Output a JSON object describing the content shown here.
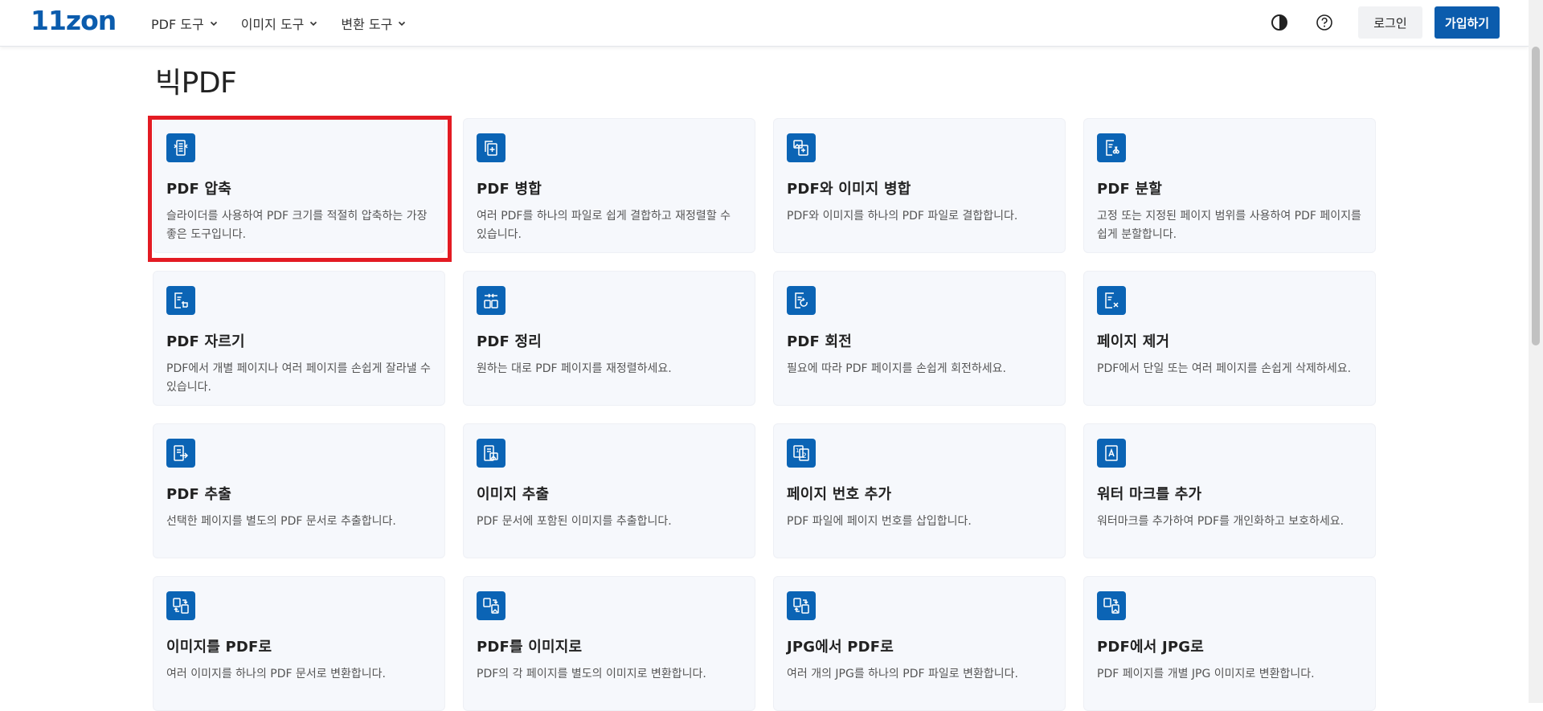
{
  "header": {
    "logo": "11zon",
    "nav": [
      {
        "label": "PDF 도구"
      },
      {
        "label": "이미지 도구"
      },
      {
        "label": "변환 도구"
      }
    ],
    "login_label": "로그인",
    "signup_label": "가입하기"
  },
  "page_title": "빅PDF",
  "colors": {
    "accent": "#0b5cad",
    "highlight": "#e31b23",
    "card_bg": "#f6f8fc"
  },
  "tools": [
    {
      "icon": "compress-icon",
      "title": "PDF 압축",
      "desc": "슬라이더를 사용하여 PDF 크기를 적절히 압축하는 가장 좋은 도구입니다."
    },
    {
      "icon": "merge-icon",
      "title": "PDF 병합",
      "desc": "여러 PDF를 하나의 파일로 쉽게 결합하고 재정렬할 수 있습니다."
    },
    {
      "icon": "merge-image-icon",
      "title": "PDF와 이미지 병합",
      "desc": "PDF와 이미지를 하나의 PDF 파일로 결합합니다."
    },
    {
      "icon": "split-icon",
      "title": "PDF 분할",
      "desc": "고정 또는 지정된 페이지 범위를 사용하여 PDF 페이지를 쉽게 분할합니다."
    },
    {
      "icon": "crop-icon",
      "title": "PDF 자르기",
      "desc": "PDF에서 개별 페이지나 여러 페이지를 손쉽게 잘라낼 수 있습니다."
    },
    {
      "icon": "organize-icon",
      "title": "PDF 정리",
      "desc": "원하는 대로 PDF 페이지를 재정렬하세요."
    },
    {
      "icon": "rotate-icon",
      "title": "PDF 회전",
      "desc": "필요에 따라 PDF 페이지를 손쉽게 회전하세요."
    },
    {
      "icon": "remove-page-icon",
      "title": "페이지 제거",
      "desc": "PDF에서 단일 또는 여러 페이지를 손쉽게 삭제하세요."
    },
    {
      "icon": "extract-icon",
      "title": "PDF 추출",
      "desc": "선택한 페이지를 별도의 PDF 문서로 추출합니다."
    },
    {
      "icon": "extract-image-icon",
      "title": "이미지 추출",
      "desc": "PDF 문서에 포함된 이미지를 추출합니다."
    },
    {
      "icon": "page-number-icon",
      "title": "페이지 번호 추가",
      "desc": "PDF 파일에 페이지 번호를 삽입합니다."
    },
    {
      "icon": "watermark-icon",
      "title": "워터 마크를 추가",
      "desc": "워터마크를 추가하여 PDF를 개인화하고 보호하세요."
    },
    {
      "icon": "image-to-pdf-icon",
      "title": "이미지를 PDF로",
      "desc": "여러 이미지를 하나의 PDF 문서로 변환합니다."
    },
    {
      "icon": "pdf-to-image-icon",
      "title": "PDF를 이미지로",
      "desc": "PDF의 각 페이지를 별도의 이미지로 변환합니다."
    },
    {
      "icon": "jpg-to-pdf-icon",
      "title": "JPG에서 PDF로",
      "desc": "여러 개의 JPG를 하나의 PDF 파일로 변환합니다."
    },
    {
      "icon": "pdf-to-jpg-icon",
      "title": "PDF에서 JPG로",
      "desc": "PDF 페이지를 개별 JPG 이미지로 변환합니다."
    }
  ]
}
